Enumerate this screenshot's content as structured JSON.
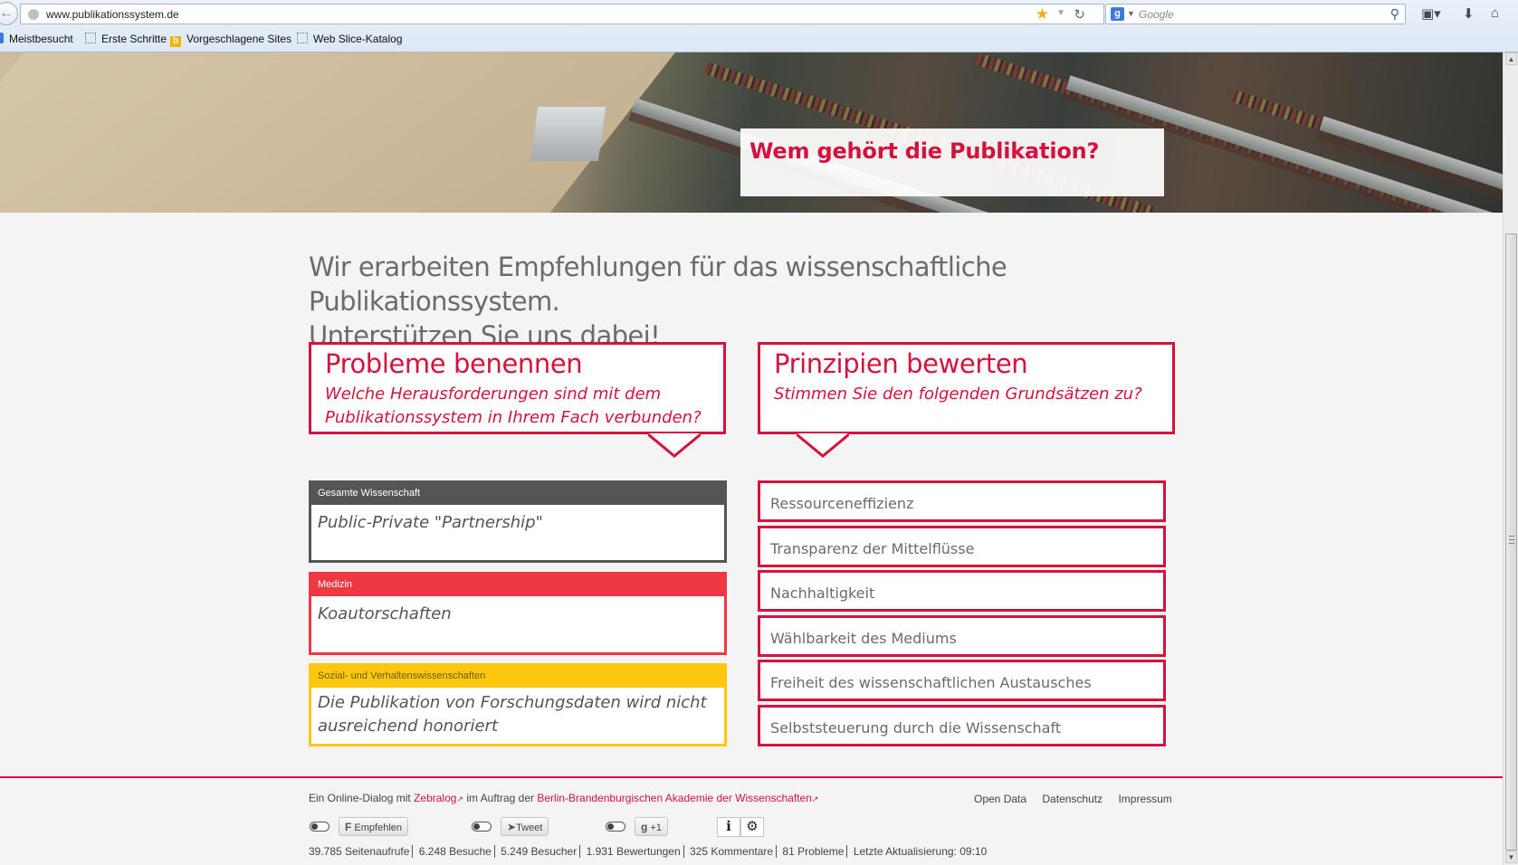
{
  "browser": {
    "url": "www.publikationssystem.de",
    "search_placeholder": "Google",
    "bookmarks": [
      "Meistbesucht",
      "Erste Schritte",
      "Vorgeschlagene Sites",
      "Web Slice-Katalog"
    ]
  },
  "hero": {
    "title": "Wem gehört die Publikation?"
  },
  "intro": {
    "line1": "Wir erarbeiten Empfehlungen für das wissenschaftliche Publikationssystem.",
    "line2": "Unterstützen Sie uns dabei!"
  },
  "problems": {
    "heading": "Probleme benennen",
    "subheading": "Welche Herausforderungen sind mit dem Publikationssystem in Ihrem Fach verbunden?",
    "cards": [
      {
        "category": "Gesamte Wissenschaft",
        "text": "Public-Private \"Partnership\"",
        "color": "#555555"
      },
      {
        "category": "Medizin",
        "text": "Koautorschaften",
        "color": "#ee3944"
      },
      {
        "category": "Sozial- und Verhaltenswissenschaften",
        "text": "Die Publikation von Forschungsdaten wird nicht ausreichend honoriert",
        "color": "#fcc70f"
      }
    ]
  },
  "principles": {
    "heading": "Prinzipien bewerten",
    "subheading": "Stimmen Sie den folgenden Grundsätzen zu?",
    "items": [
      "Ressourceneffizienz",
      "Transparenz der Mittelflüsse",
      "Nachhaltigkeit",
      "Wählbarkeit des Mediums",
      "Freiheit des wissenschaftlichen Austausches",
      "Selbststeuerung durch die Wissenschaft"
    ]
  },
  "footer": {
    "text_prefix": "Ein Online-Dialog mit",
    "zebralog": "Zebralog",
    "text_middle": "im Auftrag der",
    "bbaw": "Berlin-Brandenburgischen Akademie der Wissenschaften",
    "links": [
      "Open Data",
      "Datenschutz",
      "Impressum"
    ],
    "social": {
      "facebook": "Empfehlen",
      "twitter": "Tweet",
      "gplus": "+1"
    },
    "stats": [
      "39.785 Seitenaufrufe",
      "6.248 Besuche",
      "5.249 Besucher",
      "1.931 Bewertungen",
      "325 Kommentare",
      "81 Probleme",
      "Letzte Aktualisierung: 09:10"
    ]
  },
  "colors": {
    "accent": "#d4123c"
  }
}
